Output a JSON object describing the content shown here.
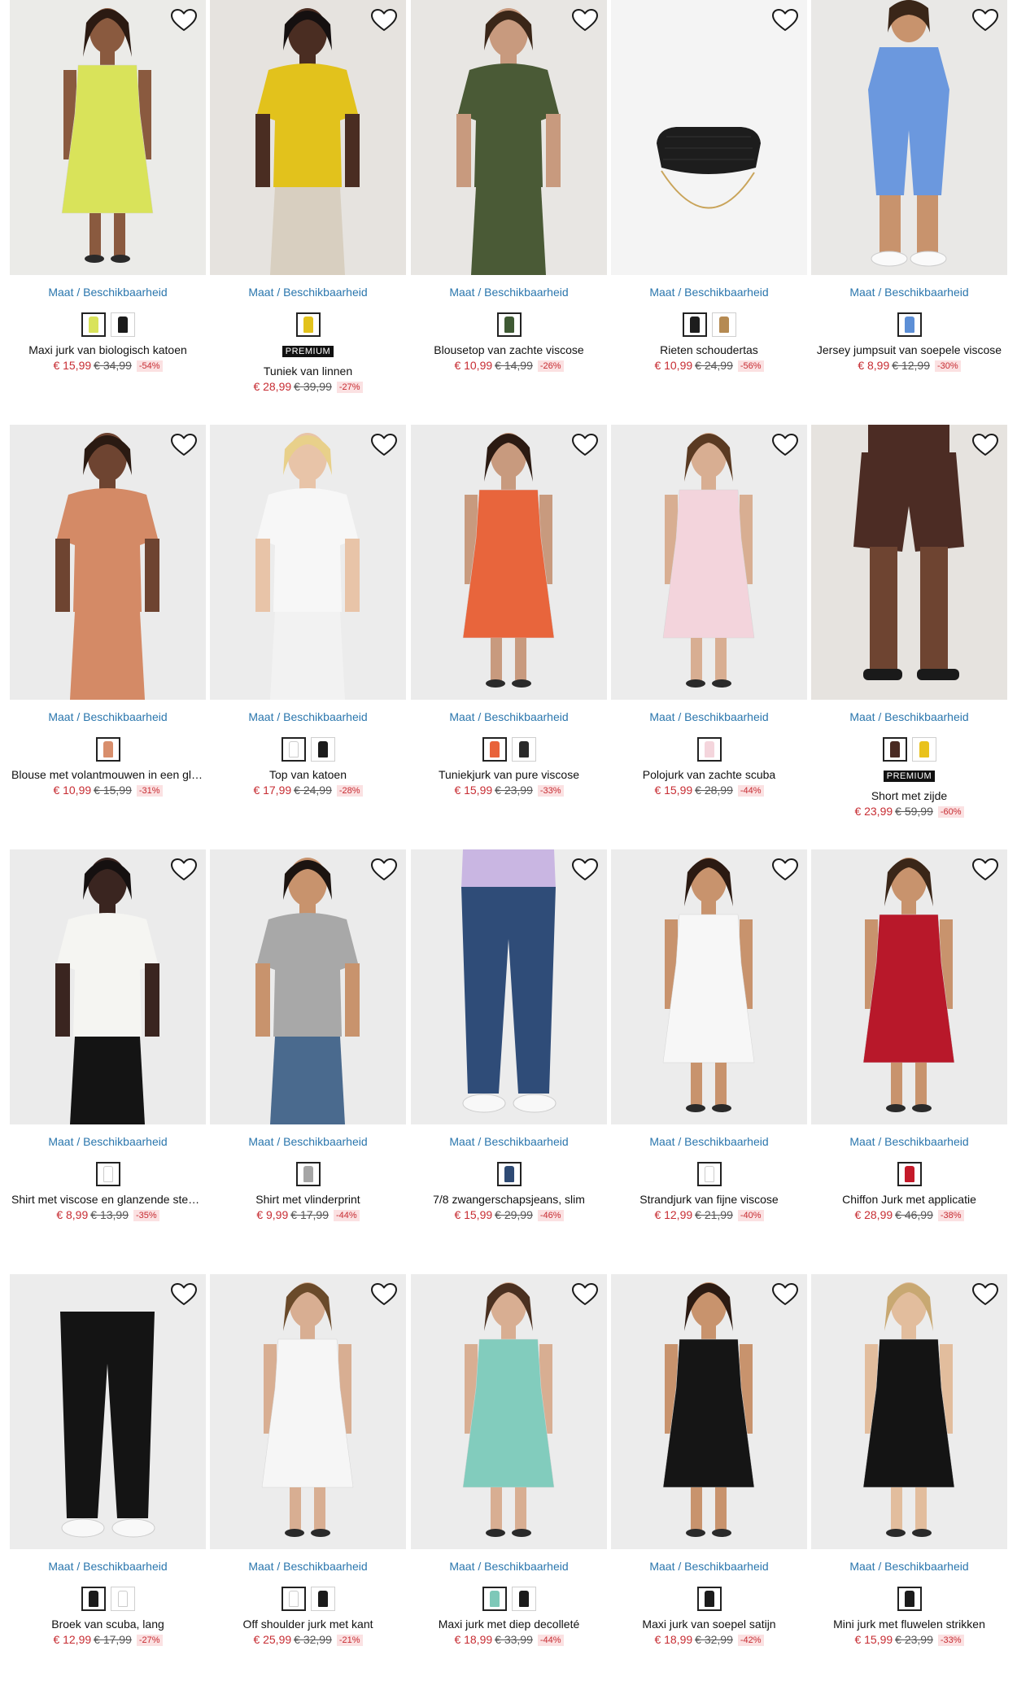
{
  "common": {
    "sizes_label": "Maat / Beschikbaarheid"
  },
  "products": [
    {
      "name": "Maxi jurk van biologisch katoen",
      "price": "€ 15,99",
      "old_price": "€ 34,99",
      "discount": "-54%",
      "premium": "",
      "bg": "#ebebe8",
      "colors": [
        "#d9e35a",
        "#1b1b1b"
      ],
      "fig": {
        "type": "dress",
        "main": "#d9e35a",
        "skin": "#8a5a3f",
        "hair": "#2b1a12"
      }
    },
    {
      "name": "Tuniek van linnen",
      "price": "€ 28,99",
      "old_price": "€ 39,99",
      "discount": "-27%",
      "premium": "PREMIUM",
      "bg": "#e6e3df",
      "colors": [
        "#e2c21c"
      ],
      "fig": {
        "type": "top",
        "main": "#e2c21c",
        "skin": "#4a2d22",
        "hair": "#151010",
        "bottom": "#d8cfc0"
      }
    },
    {
      "name": "Blousetop van zachte viscose",
      "price": "€ 10,99",
      "old_price": "€ 14,99",
      "discount": "-26%",
      "premium": "",
      "bg": "#e8e6e3",
      "colors": [
        "#3f5a34"
      ],
      "fig": {
        "type": "top",
        "main": "#4a5a36",
        "skin": "#c89a7e",
        "hair": "#3a2618",
        "bottom": "#4a5a36"
      }
    },
    {
      "name": "Rieten schoudertas",
      "price": "€ 10,99",
      "old_price": "€ 24,99",
      "discount": "-56%",
      "premium": "",
      "bg": "#f4f4f4",
      "colors": [
        "#1d1d1d",
        "#b58a52"
      ],
      "fig": {
        "type": "bag",
        "main": "#1d1d1d"
      }
    },
    {
      "name": "Jersey jumpsuit van soepele viscose",
      "price": "€ 8,99",
      "old_price": "€ 12,99",
      "discount": "-30%",
      "premium": "",
      "bg": "#e9e8e6",
      "colors": [
        "#5d8fd6"
      ],
      "fig": {
        "type": "jumpsuit",
        "main": "#6b98de",
        "skin": "#c8936d",
        "hair": "#3a2618"
      }
    },
    {
      "name": "Blouse met volantmouwen in een glanzende stof",
      "price": "€ 10,99",
      "old_price": "€ 15,99",
      "discount": "-31%",
      "premium": "",
      "bg": "#ebebeb",
      "colors": [
        "#d88e6c"
      ],
      "fig": {
        "type": "top",
        "main": "#d48a66",
        "skin": "#6e4431",
        "hair": "#2a1a12",
        "bottom": "#d48a66"
      }
    },
    {
      "name": "Top van katoen",
      "price": "€ 17,99",
      "old_price": "€ 24,99",
      "discount": "-28%",
      "premium": "",
      "bg": "#ececec",
      "colors": [
        "#ffffff",
        "#1b1b1b"
      ],
      "fig": {
        "type": "top",
        "main": "#f7f7f7",
        "skin": "#e8c4a8",
        "hair": "#e8d08a",
        "bottom": "#f2f2f2"
      }
    },
    {
      "name": "Tuniekjurk van pure viscose",
      "price": "€ 15,99",
      "old_price": "€ 23,99",
      "discount": "-33%",
      "premium": "",
      "bg": "#ebebeb",
      "colors": [
        "#e8623a",
        "#2a2a2a"
      ],
      "fig": {
        "type": "dress",
        "main": "#e8653c",
        "skin": "#c89a7e",
        "hair": "#2b1a12"
      }
    },
    {
      "name": "Polojurk van zachte scuba",
      "price": "€ 15,99",
      "old_price": "€ 28,99",
      "discount": "-44%",
      "premium": "",
      "bg": "#ececec",
      "colors": [
        "#f4d5dc"
      ],
      "fig": {
        "type": "dress",
        "main": "#f3d4dc",
        "skin": "#d8ae92",
        "hair": "#5a3a22"
      }
    },
    {
      "name": "Short met zijde",
      "price": "€ 23,99",
      "old_price": "€ 59,99",
      "discount": "-60%",
      "premium": "PREMIUM",
      "bg": "#e6e3df",
      "colors": [
        "#4a2a22",
        "#e9c21c"
      ],
      "fig": {
        "type": "shorts",
        "main": "#4c2c24",
        "skin": "#6e4431"
      }
    },
    {
      "name": "Shirt met viscose en glanzende steentjes",
      "price": "€ 8,99",
      "old_price": "€ 13,99",
      "discount": "-35%",
      "premium": "",
      "bg": "#ebebeb",
      "colors": [
        "#ffffff"
      ],
      "fig": {
        "type": "top",
        "main": "#f5f5f2",
        "skin": "#3a2520",
        "hair": "#151010",
        "bottom": "#141414"
      }
    },
    {
      "name": "Shirt met vlinderprint",
      "price": "€ 9,99",
      "old_price": "€ 17,99",
      "discount": "-44%",
      "premium": "",
      "bg": "#ebebeb",
      "colors": [
        "#a5a5a5"
      ],
      "fig": {
        "type": "top",
        "main": "#a8a8a8",
        "skin": "#c8936d",
        "hair": "#1c1410",
        "bottom": "#4a6a8e"
      }
    },
    {
      "name": "7/8 zwangerschapsjeans, slim",
      "price": "€ 15,99",
      "old_price": "€ 29,99",
      "discount": "-46%",
      "premium": "",
      "bg": "#ececec",
      "colors": [
        "#2e4a74"
      ],
      "fig": {
        "type": "pants",
        "main": "#2f4c78",
        "top": "#c9b6e2"
      }
    },
    {
      "name": "Strandjurk van fijne viscose",
      "price": "€ 12,99",
      "old_price": "€ 21,99",
      "discount": "-40%",
      "premium": "",
      "bg": "#ececec",
      "colors": [
        "#ffffff"
      ],
      "fig": {
        "type": "dress",
        "main": "#f7f7f7",
        "skin": "#c8936d",
        "hair": "#2b1a12"
      }
    },
    {
      "name": "Chiffon Jurk met applicatie",
      "price": "€ 28,99",
      "old_price": "€ 46,99",
      "discount": "-38%",
      "premium": "",
      "bg": "#ebebeb",
      "colors": [
        "#c41a2a"
      ],
      "fig": {
        "type": "dress",
        "main": "#b8182a",
        "skin": "#c8936d",
        "hair": "#3a2618"
      }
    },
    {
      "name": "Broek van scuba, lang",
      "price": "€ 12,99",
      "old_price": "€ 17,99",
      "discount": "-27%",
      "premium": "",
      "bg": "#ececec",
      "colors": [
        "#1b1b1b",
        "#ffffff"
      ],
      "fig": {
        "type": "pants",
        "main": "#141414",
        "top": "#ececec"
      }
    },
    {
      "name": "Off shoulder jurk met kant",
      "price": "€ 25,99",
      "old_price": "€ 32,99",
      "discount": "-21%",
      "premium": "",
      "bg": "#ececec",
      "colors": [
        "#ffffff",
        "#1b1b1b"
      ],
      "fig": {
        "type": "dress",
        "main": "#f6f6f6",
        "skin": "#d8ae92",
        "hair": "#6a4a2a"
      }
    },
    {
      "name": "Maxi jurk met diep decolleté",
      "price": "€ 18,99",
      "old_price": "€ 33,99",
      "discount": "-44%",
      "premium": "",
      "bg": "#ececec",
      "colors": [
        "#7ec8b8",
        "#1b1b1b"
      ],
      "fig": {
        "type": "dress",
        "main": "#82ccbd",
        "skin": "#d8ae92",
        "hair": "#4a3020"
      }
    },
    {
      "name": "Maxi jurk van soepel satijn",
      "price": "€ 18,99",
      "old_price": "€ 32,99",
      "discount": "-42%",
      "premium": "",
      "bg": "#ececec",
      "colors": [
        "#1b1b1b"
      ],
      "fig": {
        "type": "dress",
        "main": "#151515",
        "skin": "#c8936d",
        "hair": "#2b1a12"
      }
    },
    {
      "name": "Mini jurk met fluwelen strikken",
      "price": "€ 15,99",
      "old_price": "€ 23,99",
      "discount": "-33%",
      "premium": "",
      "bg": "#ececec",
      "colors": [
        "#1b1b1b"
      ],
      "fig": {
        "type": "dress",
        "main": "#141414",
        "skin": "#e2bd9d",
        "hair": "#c8a872"
      }
    }
  ]
}
